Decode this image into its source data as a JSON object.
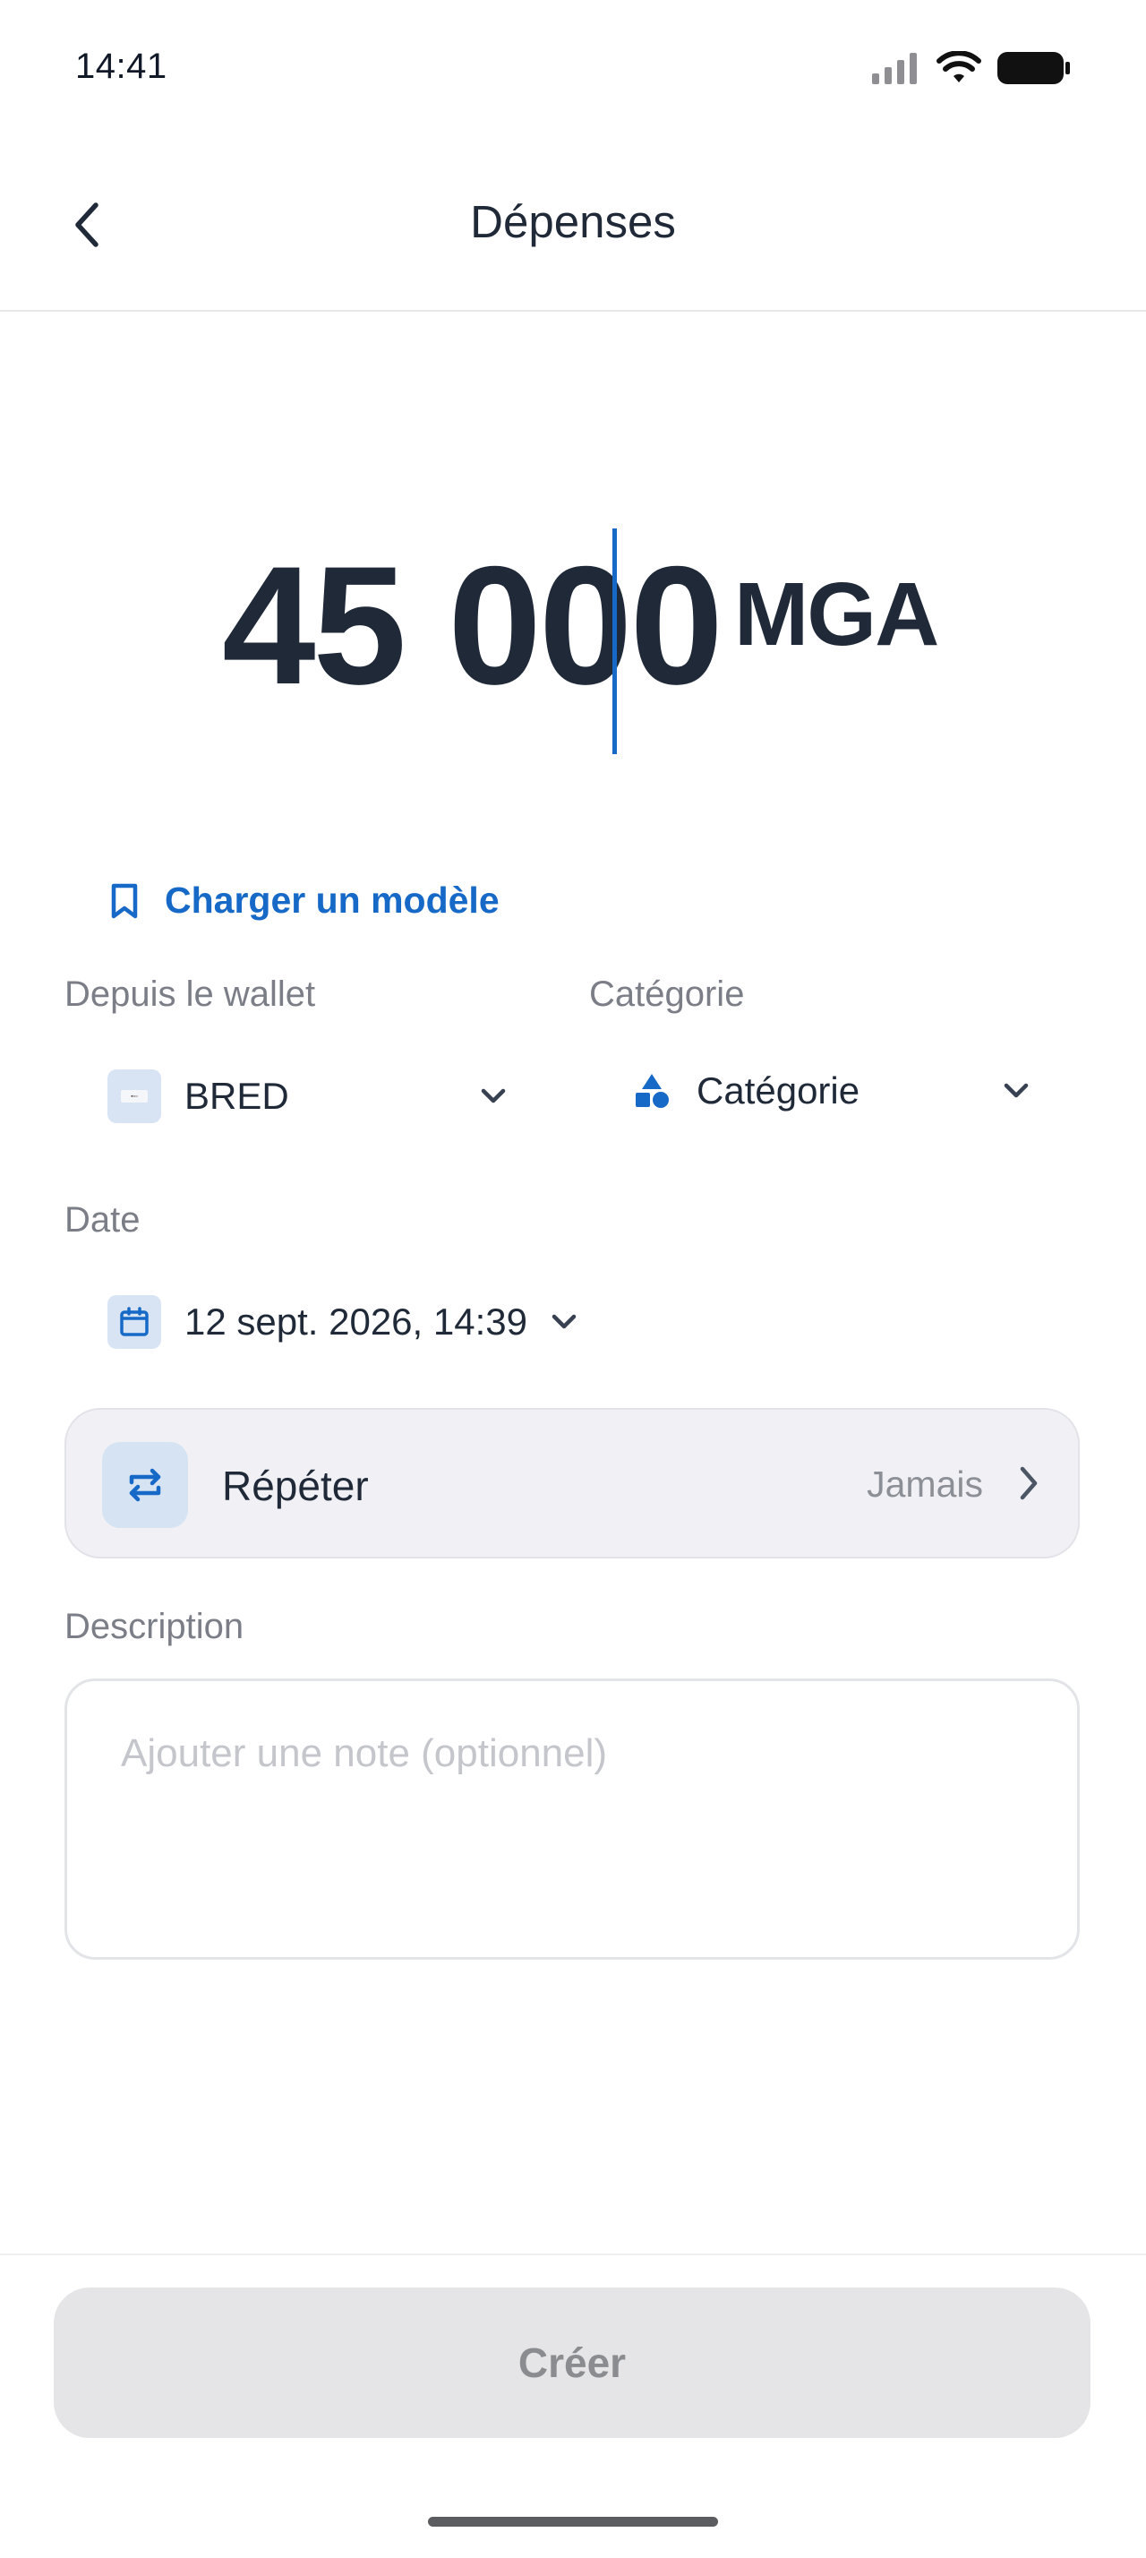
{
  "status_bar": {
    "time": "14:41"
  },
  "nav": {
    "title": "Dépenses"
  },
  "amount": {
    "value": "45 000",
    "currency": "MGA"
  },
  "template_link": {
    "label": "Charger un modèle"
  },
  "wallet": {
    "label": "Depuis le wallet",
    "value": "BRED"
  },
  "category": {
    "label": "Catégorie",
    "value": "Catégorie"
  },
  "date": {
    "label": "Date",
    "value": "12 sept. 2026, 14:39"
  },
  "repeat": {
    "label": "Répéter",
    "value": "Jamais"
  },
  "description": {
    "label": "Description",
    "placeholder": "Ajouter une note (optionnel)"
  },
  "create_button": {
    "label": "Créer"
  },
  "colors": {
    "accent": "#1769c7",
    "text": "#1f2937",
    "muted": "#7b7e86",
    "disabled_bg": "#e5e5e7"
  }
}
